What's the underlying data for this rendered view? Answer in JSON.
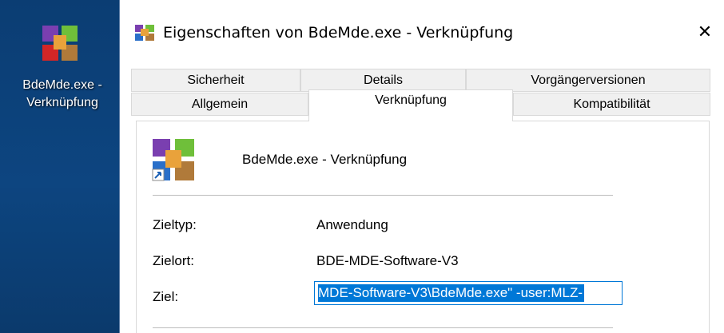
{
  "desktop": {
    "icon_label_line1": "BdeMde.exe -",
    "icon_label_line2": "Verknüpfung"
  },
  "dialog": {
    "title": "Eigenschaften von BdeMde.exe - Verknüpfung",
    "close_glyph": "✕",
    "tabs_top": [
      {
        "label": "Sicherheit"
      },
      {
        "label": "Details"
      },
      {
        "label": "Vorgängerversionen"
      }
    ],
    "tabs_bottom": [
      {
        "label": "Allgemein"
      },
      {
        "label": "Verknüpfung",
        "active": true
      },
      {
        "label": "Kompatibilität"
      }
    ],
    "app_name": "BdeMde.exe - Verknüpfung",
    "fields": {
      "zieltyp_label": "Zieltyp:",
      "zieltyp_value": "Anwendung",
      "zielort_label": "Zielort:",
      "zielort_value": "BDE-MDE-Software-V3",
      "ziel_label": "Ziel:",
      "ziel_value": "MDE-Software-V3\\BdeMde.exe\" -user:MLZ-"
    }
  },
  "colors": {
    "selection": "#0078d7",
    "desktop": "#0b3d73"
  }
}
